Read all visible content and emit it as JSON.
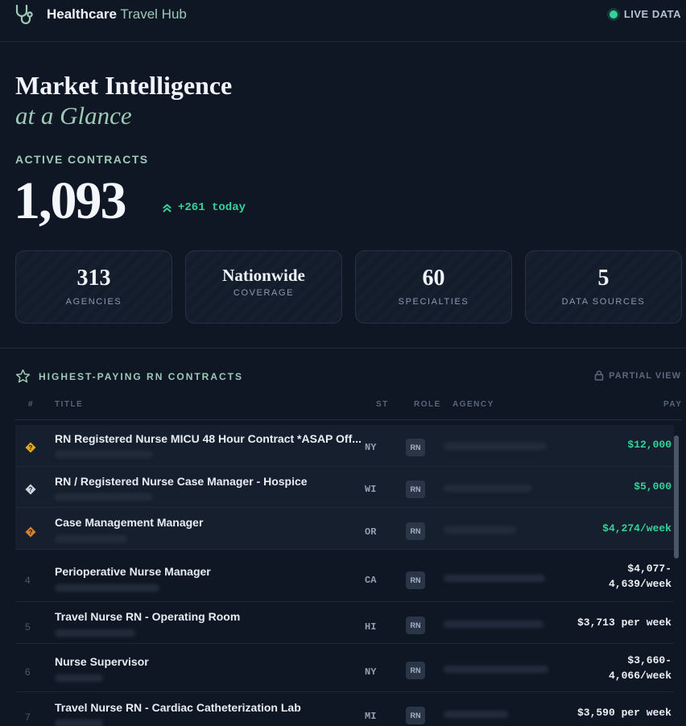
{
  "header": {
    "brand_main": "Healthcare",
    "brand_accent": " Travel Hub",
    "live_label": "LIVE DATA"
  },
  "hero": {
    "title": "Market Intelligence",
    "subtitle": "at a Glance"
  },
  "contracts": {
    "label": "ACTIVE CONTRACTS",
    "value": "1,093",
    "delta": "+261 today"
  },
  "stats": [
    {
      "value": "313",
      "label": "AGENCIES"
    },
    {
      "value": "Nationwide",
      "label": "COVERAGE"
    },
    {
      "value": "60",
      "label": "SPECIALTIES"
    },
    {
      "value": "5",
      "label": "DATA SOURCES"
    }
  ],
  "list": {
    "title": "HIGHEST-PAYING RN CONTRACTS",
    "partial_view": "PARTIAL VIEW",
    "columns": {
      "rank": "#",
      "title": "TITLE",
      "state": "ST",
      "role": "ROLE",
      "agency": "AGENCY",
      "pay": "PAY"
    },
    "rows": [
      {
        "rank": "1",
        "title": "RN Registered Nurse MICU 48 Hour Contract *ASAP Off...",
        "state": "NY",
        "role": "RN",
        "pay_line1": "$12,000",
        "pay_line2": ""
      },
      {
        "rank": "2",
        "title": "RN / Registered Nurse Case Manager - Hospice",
        "state": "WI",
        "role": "RN",
        "pay_line1": "$5,000",
        "pay_line2": ""
      },
      {
        "rank": "3",
        "title": "Case Management Manager",
        "state": "OR",
        "role": "RN",
        "pay_line1": "$4,274/week",
        "pay_line2": ""
      },
      {
        "rank": "4",
        "title": "Perioperative Nurse Manager",
        "state": "CA",
        "role": "RN",
        "pay_line1": "$4,077-",
        "pay_line2": "4,639/week"
      },
      {
        "rank": "5",
        "title": "Travel Nurse RN - Operating Room",
        "state": "HI",
        "role": "RN",
        "pay_line1": "$3,713 per week",
        "pay_line2": ""
      },
      {
        "rank": "6",
        "title": "Nurse Supervisor",
        "state": "NY",
        "role": "RN",
        "pay_line1": "$3,660-",
        "pay_line2": "4,066/week"
      },
      {
        "rank": "7",
        "title": "Travel Nurse RN - Cardiac Catheterization Lab",
        "state": "MI",
        "role": "RN",
        "pay_line1": "$3,590 per week",
        "pay_line2": ""
      }
    ]
  },
  "colors": {
    "background": "#0f1724",
    "accent_green": "#34d399",
    "sage": "#9ec9b6",
    "gold": "#e3a81d",
    "silver": "#cfd5dd",
    "bronze": "#d5822f"
  },
  "icons": [
    "stethoscope-icon",
    "live-dot-icon",
    "double-chevron-up-icon",
    "star-icon",
    "lock-icon",
    "medal-gold-icon",
    "medal-silver-icon",
    "medal-bronze-icon"
  ]
}
